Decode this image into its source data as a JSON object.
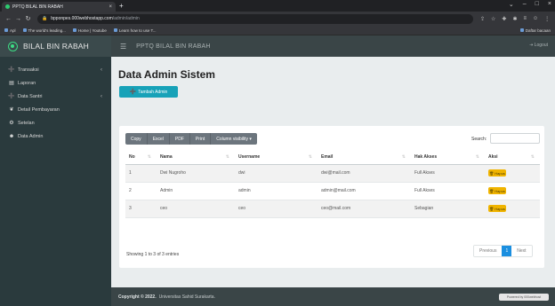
{
  "browser": {
    "tab_title": "PPTQ BILAL BIN RABAH",
    "new_tab": "+",
    "url_host": "bpponpes.000webhostapp.com",
    "url_path": "/admin/admin",
    "bookmarks": [
      "Apl",
      "The world's leading...",
      "Home | Youtube",
      "Learn how to use T..."
    ],
    "bookmark_right": "Daftar bacaan"
  },
  "sidebar": {
    "brand": "BILAL BIN RABAH",
    "items": [
      {
        "label": "Transaksi",
        "icon": "user-plus-icon",
        "has_children": true
      },
      {
        "label": "Laporan",
        "icon": "file-icon",
        "has_children": false
      },
      {
        "label": "Data Santri",
        "icon": "user-plus-icon",
        "has_children": true
      },
      {
        "label": "Detail Pembayaran",
        "icon": "leaf-icon",
        "has_children": false
      },
      {
        "label": "Setelan",
        "icon": "gears-icon",
        "has_children": false
      },
      {
        "label": "Data Admin",
        "icon": "users-icon",
        "has_children": false
      }
    ]
  },
  "header": {
    "title": "PPTQ BILAL BIN RABAH",
    "logout": "Logout"
  },
  "main": {
    "page_title": "Data Admin Sistem",
    "add_button": "Tambah Admin",
    "toolbar": [
      "Copy",
      "Excel",
      "PDF",
      "Print",
      "Column visibility"
    ],
    "search_label": "Search:",
    "search_value": "",
    "columns": [
      "No",
      "Nama",
      "Username",
      "Email",
      "Hak Akses",
      "Aksi"
    ],
    "rows": [
      {
        "no": "1",
        "nama": "Dwi Nugroho",
        "username": "dwi",
        "email": "dwi@mail.com",
        "hak_akses": "Full Akses"
      },
      {
        "no": "2",
        "nama": "Admin",
        "username": "admin",
        "email": "admin@mail.com",
        "hak_akses": "Full Akses"
      },
      {
        "no": "3",
        "nama": "ceo",
        "username": "ceo",
        "email": "ceo@mail.com",
        "hak_akses": "Sebagian"
      }
    ],
    "delete_label": "Hapus",
    "info": "Showing 1 to 3 of 3 entries",
    "pager": {
      "previous": "Previous",
      "current": "1",
      "next": "Next"
    }
  },
  "footer": {
    "copyright_bold": "Copyright © 2022.",
    "copyright_rest": "Universitas Sahid Surakarta.",
    "powered": "Powered by 000webhost"
  }
}
